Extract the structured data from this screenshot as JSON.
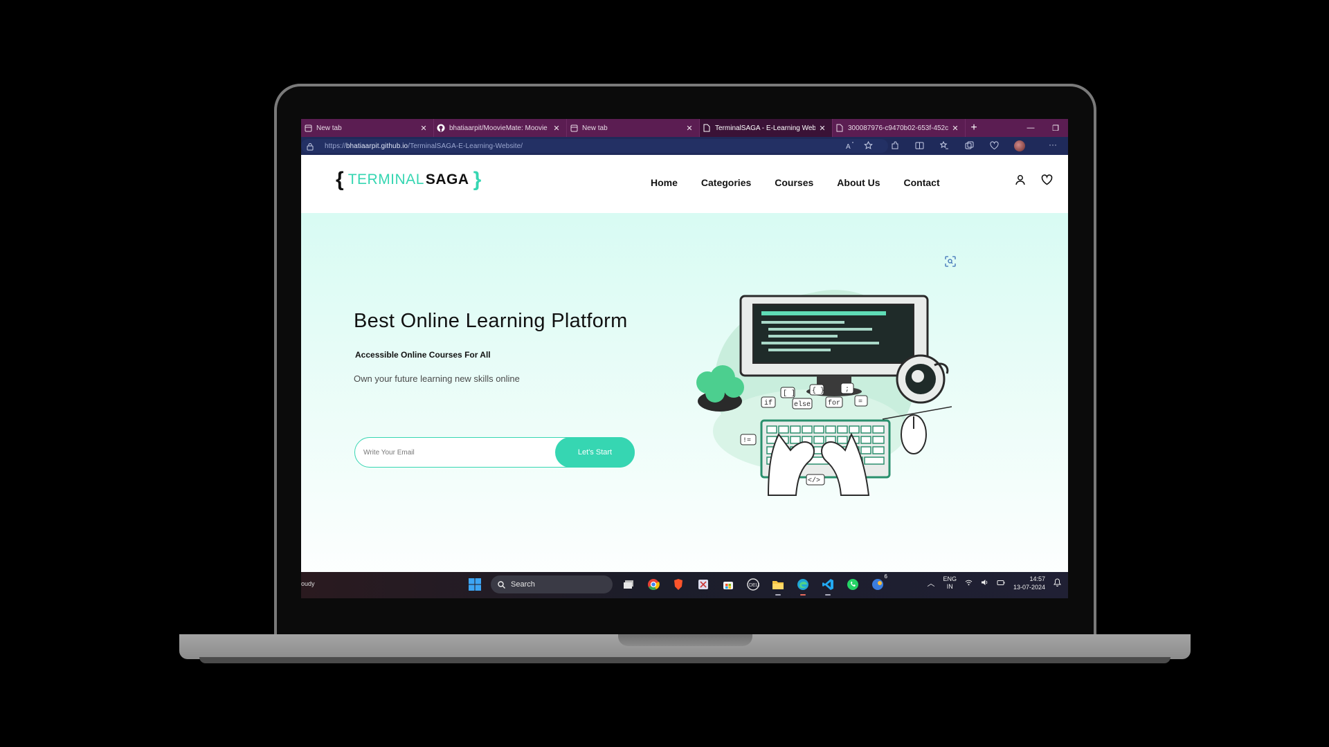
{
  "browser": {
    "tabs": [
      {
        "label": "New tab",
        "icon": "page-icon",
        "active": false
      },
      {
        "label": "bhatiaarpit/MoovieMate: Moovie",
        "icon": "github-icon",
        "active": false
      },
      {
        "label": "New tab",
        "icon": "page-icon",
        "active": false
      },
      {
        "label": "TerminalSAGA - E-Learning Web",
        "icon": "document-icon",
        "active": true
      },
      {
        "label": "300087976-c9470b02-653f-452c-8",
        "icon": "document-icon",
        "active": false
      }
    ],
    "url_prefix": "https://",
    "url_host": "bhatiaarpit.github.io",
    "url_path": "/TerminalSAGA-E-Learning-Website/",
    "colors": {
      "tabbar": "#5b1d52",
      "addressbar": "#1f2a5a"
    }
  },
  "site": {
    "logo_open": "{",
    "logo_terminal": "TERMINAL",
    "logo_saga": "SAGA",
    "logo_close": "}",
    "nav": [
      "Home",
      "Categories",
      "Courses",
      "About Us",
      "Contact"
    ],
    "accent": "#36d6b2"
  },
  "hero": {
    "title": "Best Online Learning Platform",
    "subtitle": "Accessible Online Courses For All",
    "description": "Own your future learning new skills online",
    "email_placeholder": "Write Your Email",
    "cta_label": "Let's Start"
  },
  "illustration": {
    "labels": [
      "[ ]",
      "{ }",
      ";",
      "if",
      "else",
      "for",
      "=",
      "!=",
      "</>"
    ]
  },
  "taskbar": {
    "weather_text": "oudy",
    "search_label": "Search",
    "lang_line1": "ENG",
    "lang_line2": "IN",
    "time": "14:57",
    "date": "13-07-2024",
    "badge_count": "6"
  }
}
